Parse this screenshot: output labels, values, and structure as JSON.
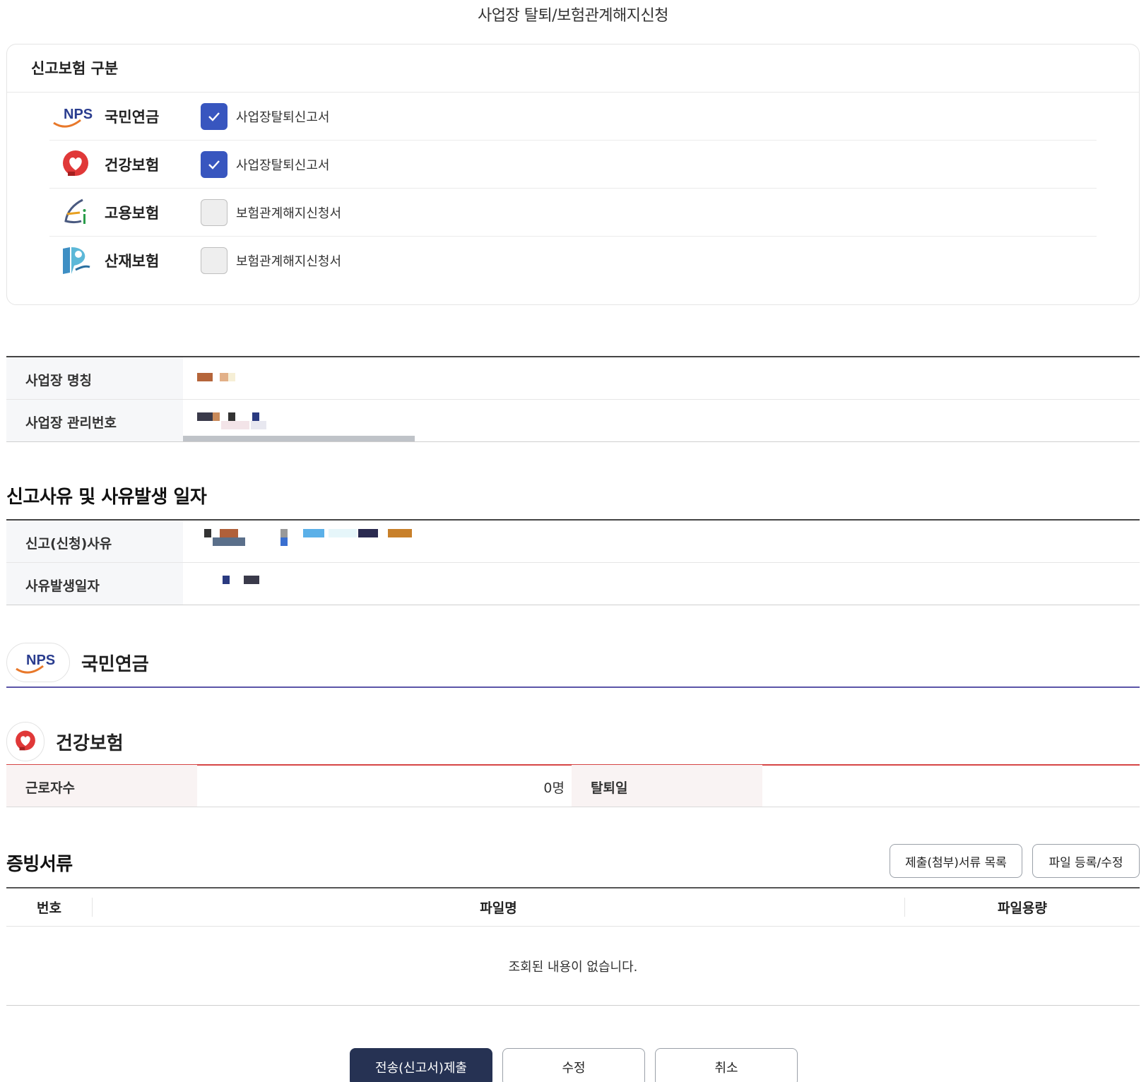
{
  "page": {
    "title": "사업장 탈퇴/보험관계해지신청"
  },
  "insurance_selection": {
    "heading": "신고보험 구분",
    "items": [
      {
        "name": "국민연금",
        "document": "사업장탈퇴신고서",
        "checked": true,
        "icon": "nps-logo-icon"
      },
      {
        "name": "건강보험",
        "document": "사업장탈퇴신고서",
        "checked": true,
        "icon": "health-insurance-logo-icon"
      },
      {
        "name": "고용보험",
        "document": "보험관계해지신청서",
        "checked": false,
        "icon": "employment-insurance-logo-icon"
      },
      {
        "name": "산재보험",
        "document": "보험관계해지신청서",
        "checked": false,
        "icon": "industrial-accident-logo-icon"
      }
    ]
  },
  "workplace": {
    "name_label": "사업장 명칭",
    "number_label": "사업장 관리번호"
  },
  "reason_section": {
    "title": "신고사유 및 사유발생 일자",
    "reason_label": "신고(신청)사유",
    "date_label": "사유발생일자"
  },
  "nps_section": {
    "title": "국민연금",
    "logo_text": "NPS"
  },
  "health_section": {
    "title": "건강보험",
    "workers_label": "근로자수",
    "workers_value": "0명",
    "withdraw_date_label": "탈퇴일"
  },
  "documents": {
    "title": "증빙서류",
    "list_button": "제출(첨부)서류 목록",
    "upload_button": "파일 등록/수정",
    "columns": [
      "번호",
      "파일명",
      "파일용량"
    ],
    "empty_message": "조회된 내용이 없습니다."
  },
  "actions": {
    "submit": "전송(신고서)제출",
    "edit": "수정",
    "cancel": "취소"
  },
  "colors": {
    "primary_button": "#263253",
    "checkbox_checked": "#3856bf",
    "nps_divider": "#5b55a8",
    "health_divider": "#d64545"
  }
}
